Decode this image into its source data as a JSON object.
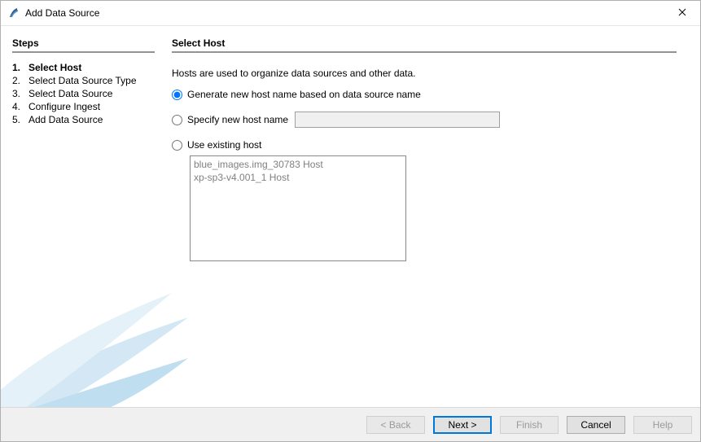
{
  "window": {
    "title": "Add Data Source"
  },
  "sidebar": {
    "heading": "Steps",
    "steps": [
      {
        "num": "1.",
        "label": "Select Host",
        "current": true
      },
      {
        "num": "2.",
        "label": "Select Data Source Type",
        "current": false
      },
      {
        "num": "3.",
        "label": "Select Data Source",
        "current": false
      },
      {
        "num": "4.",
        "label": "Configure Ingest",
        "current": false
      },
      {
        "num": "5.",
        "label": "Add Data Source",
        "current": false
      }
    ]
  },
  "main": {
    "heading": "Select Host",
    "description": "Hosts are used to organize data sources and other data.",
    "options": {
      "generate_label": "Generate new host name based on data source name",
      "specify_label": "Specify new host name",
      "specify_value": "",
      "specify_placeholder": "",
      "existing_label": "Use existing host",
      "selected": "generate",
      "existing_hosts": [
        "blue_images.img_30783 Host",
        "xp-sp3-v4.001_1 Host"
      ]
    }
  },
  "buttons": {
    "back": "< Back",
    "next": "Next >",
    "finish": "Finish",
    "cancel": "Cancel",
    "help": "Help"
  }
}
